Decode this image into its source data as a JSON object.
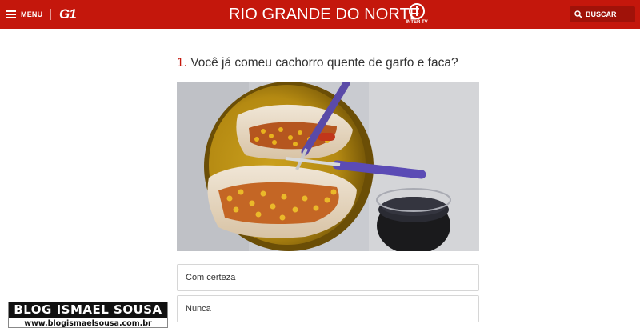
{
  "header": {
    "menu_label": "MENU",
    "logo_text": "G1",
    "region_title": "RIO GRANDE DO NORTE",
    "affiliate_logo_text": "INTER TV",
    "search_label": "BUSCAR",
    "brand_color": "#c4170c"
  },
  "quiz": {
    "question_number": "1.",
    "question_text": "Você já comeu cachorro quente de garfo e faca?",
    "options": [
      {
        "label": "Com certeza"
      },
      {
        "label": "Nunca"
      }
    ]
  },
  "watermark": {
    "title": "BLOG ISMAEL SOUSA",
    "url": "www.blogismaelsousa.com.br"
  }
}
